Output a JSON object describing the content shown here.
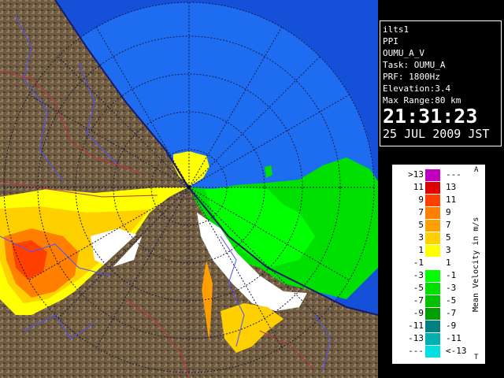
{
  "info": {
    "site": "ilts1",
    "scan_type": "PPI",
    "product": "OUMU_A_V",
    "task": "Task: OUMU_A",
    "prf": "PRF: 1800Hz",
    "elevation": "Elevation:3.4",
    "max_range": "Max Range:80 km",
    "time": "21:31:23",
    "date": "25 JUL 2009 JST"
  },
  "legend": {
    "title": "Mean Velocity in m/s",
    "cap_top": "A",
    "cap_bottom": "T",
    "rows": [
      {
        "lo": ">13",
        "hi": "---",
        "color": "#c000c0"
      },
      {
        "lo": "11",
        "hi": "13",
        "color": "#e00000"
      },
      {
        "lo": "9",
        "hi": "11",
        "color": "#ff4000"
      },
      {
        "lo": "7",
        "hi": "9",
        "color": "#ff8000"
      },
      {
        "lo": "5",
        "hi": "7",
        "color": "#ffa000"
      },
      {
        "lo": "3",
        "hi": "5",
        "color": "#ffd000"
      },
      {
        "lo": "1",
        "hi": "3",
        "color": "#ffff00"
      },
      {
        "lo": "-1",
        "hi": "1",
        "color": "#ffffff"
      },
      {
        "lo": "-3",
        "hi": "-1",
        "color": "#00ff00"
      },
      {
        "lo": "-5",
        "hi": "-3",
        "color": "#00e000"
      },
      {
        "lo": "-7",
        "hi": "-5",
        "color": "#00c000"
      },
      {
        "lo": "-9",
        "hi": "-7",
        "color": "#00a000"
      },
      {
        "lo": "-11",
        "hi": "-9",
        "color": "#008080"
      },
      {
        "lo": "-13",
        "hi": "-11",
        "color": "#00b0b0"
      },
      {
        "lo": "---",
        "hi": "<-13",
        "color": "#00e0e0"
      }
    ]
  },
  "colors": {
    "sea": "#1e6cf0",
    "sea_far": "#1450d8",
    "land": "#6e5a40",
    "coast": "#1a1a6a",
    "river": "#5050ff",
    "boundary": "#c03040",
    "range_ring": "#1a1a40"
  }
}
